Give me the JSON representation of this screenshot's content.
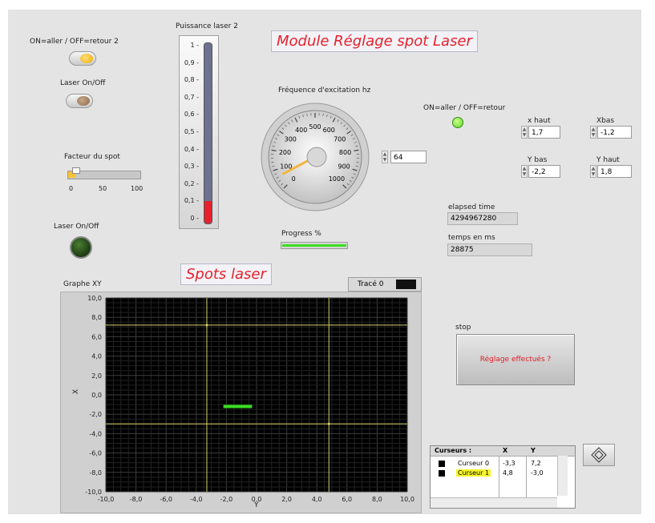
{
  "titles": {
    "module": "Module Réglage spot Laser",
    "spots": "Spots laser"
  },
  "controls": {
    "on_aller_2": "ON=aller / OFF=retour 2",
    "laser_onoff_1": "Laser On/Off",
    "laser_onoff_2": "Laser On/Off",
    "on_aller": "ON=aller / OFF=retour",
    "facteur_label": "Facteur du spot",
    "facteur_ticks": [
      "0",
      "50",
      "100"
    ],
    "facteur_value": 10
  },
  "laser_power": {
    "label": "Puissance laser 2",
    "ticks": [
      "1",
      "0,9",
      "0,8",
      "0,7",
      "0,6",
      "0,5",
      "0,4",
      "0,3",
      "0,2",
      "0,1",
      "0"
    ],
    "value": 0.1
  },
  "frequency": {
    "label": "Fréquence d'excitation hz",
    "dial_ticks": [
      "0",
      "100",
      "200",
      "300",
      "400",
      "500",
      "600",
      "700",
      "800",
      "900",
      "1000"
    ],
    "value": 64,
    "value_text": "64"
  },
  "coords": {
    "x_haut_label": "x haut",
    "x_haut_value": "1,7",
    "xbas_label": "Xbas",
    "xbas_value": "-1,2",
    "y_bas_label": "Y bas",
    "y_bas_value": "-2,2",
    "y_haut_label": "Y haut",
    "y_haut_value": "1,8"
  },
  "timing": {
    "elapsed_label": "elapsed time",
    "elapsed_value": "4294967280",
    "temps_label": "temps en ms",
    "temps_value": "28875"
  },
  "progress": {
    "label": "Progress %",
    "value": 100
  },
  "stop": {
    "label": "stop",
    "button_text": "Réglage effectués ?"
  },
  "graph": {
    "label": "Graphe XY",
    "legend": "Tracé 0",
    "xlabel": "Y",
    "ylabel": "X",
    "ticks": [
      "10,0",
      "8,0",
      "6,0",
      "4,0",
      "2,0",
      "0,0",
      "-2,0",
      "-4,0",
      "-6,0",
      "-8,0",
      "-10,0"
    ],
    "xticks": [
      "-10,0",
      "-8,0",
      "-6,0",
      "-4,0",
      "-2,0",
      "0,0",
      "2,0",
      "4,0",
      "6,0",
      "8,0",
      "10,0"
    ]
  },
  "chart_data": {
    "type": "scatter",
    "xlim": [
      -10,
      10
    ],
    "ylim": [
      -10,
      10
    ],
    "xlabel": "Y",
    "ylabel": "X",
    "grid": true,
    "series": [
      {
        "name": "Tracé 0",
        "x": [
          -2.2,
          -0.3
        ],
        "y": [
          -1.2,
          -1.2
        ]
      }
    ],
    "cursors": [
      {
        "name": "Curseur 0",
        "x": -3.3,
        "y": 7.2
      },
      {
        "name": "Curseur 1",
        "x": 4.8,
        "y": -3.0
      }
    ]
  },
  "cursor_table": {
    "headers": [
      "Curseurs :",
      "X",
      "Y"
    ],
    "rows": [
      {
        "name": "Curseur 0",
        "x": "-3,3",
        "y": "7,2"
      },
      {
        "name": "Curseur 1",
        "x": "4,8",
        "y": "-3,0"
      }
    ]
  },
  "colors": {
    "title_red": "#e8202c",
    "led_green": "#5fdc2a",
    "trace_green": "#39e021",
    "thermo_red": "#e8202c",
    "needle": "#f3b53a"
  }
}
